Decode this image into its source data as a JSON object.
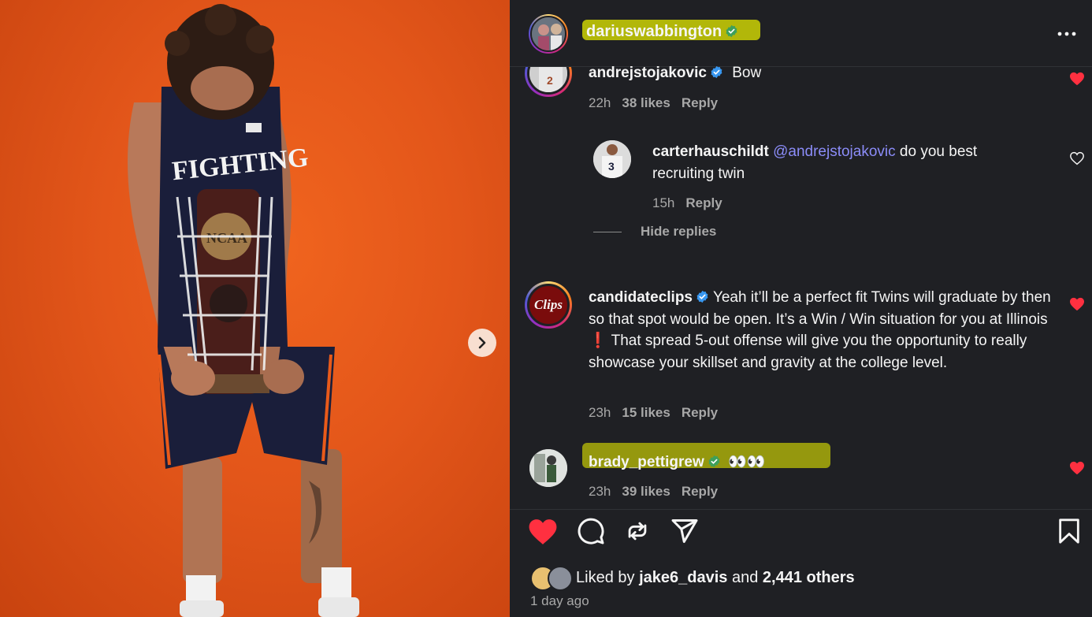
{
  "post": {
    "author": "dariuswabbington",
    "more_icon": "more-horizontal-icon"
  },
  "comments": [
    {
      "user": "andrejstojakovic",
      "text": "Bow",
      "time": "22h",
      "likes": "38 likes",
      "reply": "Reply",
      "liked": true
    },
    {
      "user": "carterhauschildt",
      "mention": "@andrejstojakovic",
      "text": "do you best recruiting twin",
      "time": "15h",
      "reply": "Reply",
      "liked": false,
      "hide_replies": "Hide replies"
    },
    {
      "user": "candidateclips",
      "avatar_text": "Clips",
      "text": "Yeah it’ll be a perfect fit Twins will graduate by then so that spot would be open. It’s a Win / Win situation for you at Illinois ❗ That spread 5-out offense will give you the opportunity to really showcase your skillset and gravity at the college level.",
      "time": "23h",
      "likes": "15 likes",
      "reply": "Reply",
      "liked": true
    },
    {
      "user": "brady_pettigrew",
      "text": "👀👀",
      "time": "23h",
      "likes": "39 likes",
      "reply": "Reply",
      "liked": true
    }
  ],
  "actions": {
    "like": "heart-filled-icon",
    "comment": "comment-icon",
    "share": "repost-icon",
    "send": "send-icon",
    "save": "bookmark-icon"
  },
  "likes": {
    "prefix": "Liked by",
    "user": "jake6_davis",
    "mid": "and",
    "others": "2,441 others"
  },
  "posted_ago": "1 day ago",
  "colors": {
    "background": "#1f2024",
    "heart_red": "#ff3040",
    "mention": "#8b8cf8",
    "meta_gray": "#a8a8a8",
    "highlight": "#e4ea00",
    "photo_orange": "#e3561a"
  }
}
